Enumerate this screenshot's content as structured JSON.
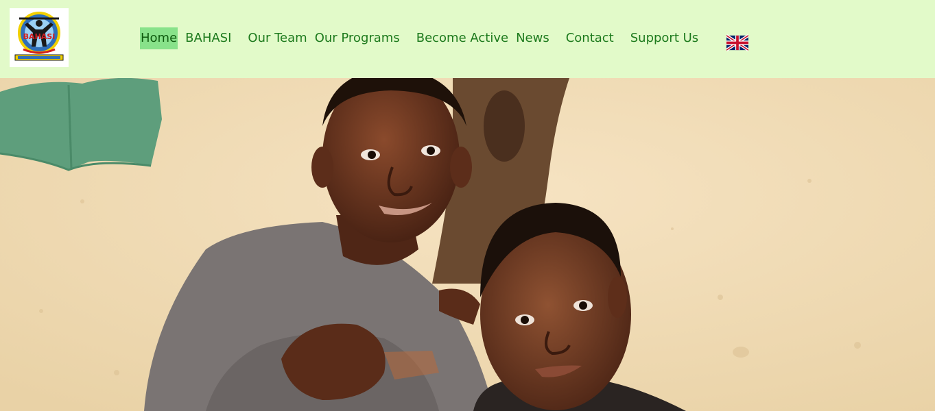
{
  "header": {
    "logo": {
      "icon": "bahasi-logo",
      "text": "BAHASI"
    },
    "nav": [
      {
        "label": "Home",
        "active": true
      },
      {
        "label": "BAHASI",
        "active": false
      },
      {
        "label": "Our Team",
        "active": false
      },
      {
        "label": "Our Programs",
        "active": false
      },
      {
        "label": "Become Active",
        "active": false
      },
      {
        "label": "News",
        "active": false
      },
      {
        "label": "Contact",
        "active": false
      },
      {
        "label": "Support Us",
        "active": false
      }
    ],
    "language": {
      "icon": "uk-flag-icon"
    }
  },
  "hero": {
    "image": "photo-two-children-against-wall"
  },
  "colors": {
    "header_bg": "#e2fac9",
    "nav_text": "#1d7a1d",
    "nav_active_bg": "#88e28a"
  }
}
